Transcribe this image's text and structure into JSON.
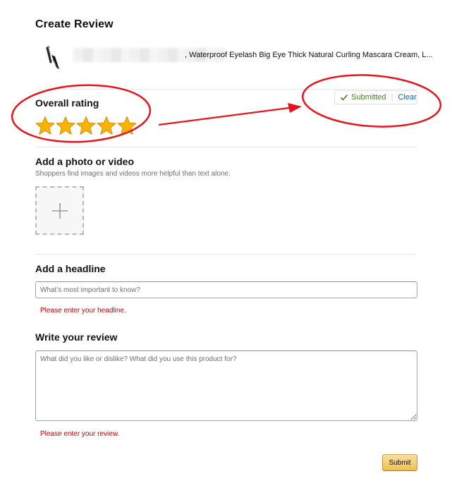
{
  "page": {
    "title": "Create Review"
  },
  "product": {
    "name": ", Waterproof Eyelash Big Eye Thick Natural Curling Mascara Cream, L...",
    "thumbnail_icon": "mascara-icon"
  },
  "rating": {
    "heading": "Overall rating",
    "value": 5,
    "max": 5,
    "star_color": "#f7b500",
    "status_label": "Submitted",
    "status_separator": "|",
    "clear_label": "Clear",
    "status_color": "#4a7c28",
    "link_color": "#0066c0"
  },
  "media": {
    "heading": "Add a photo or video",
    "hint": "Shoppers find images and videos more helpful than text alone.",
    "upload_icon": "plus-icon"
  },
  "headline": {
    "heading": "Add a headline",
    "placeholder": "What's most important to know?",
    "value": "",
    "error": "Please enter your headline."
  },
  "review": {
    "heading": "Write your review",
    "placeholder": "What did you like or dislike? What did you use this product for?",
    "value": "",
    "error": "Please enter your review."
  },
  "submit": {
    "label": "Submit",
    "color": "#f0c14b"
  },
  "annotation_color": "#e8141c"
}
